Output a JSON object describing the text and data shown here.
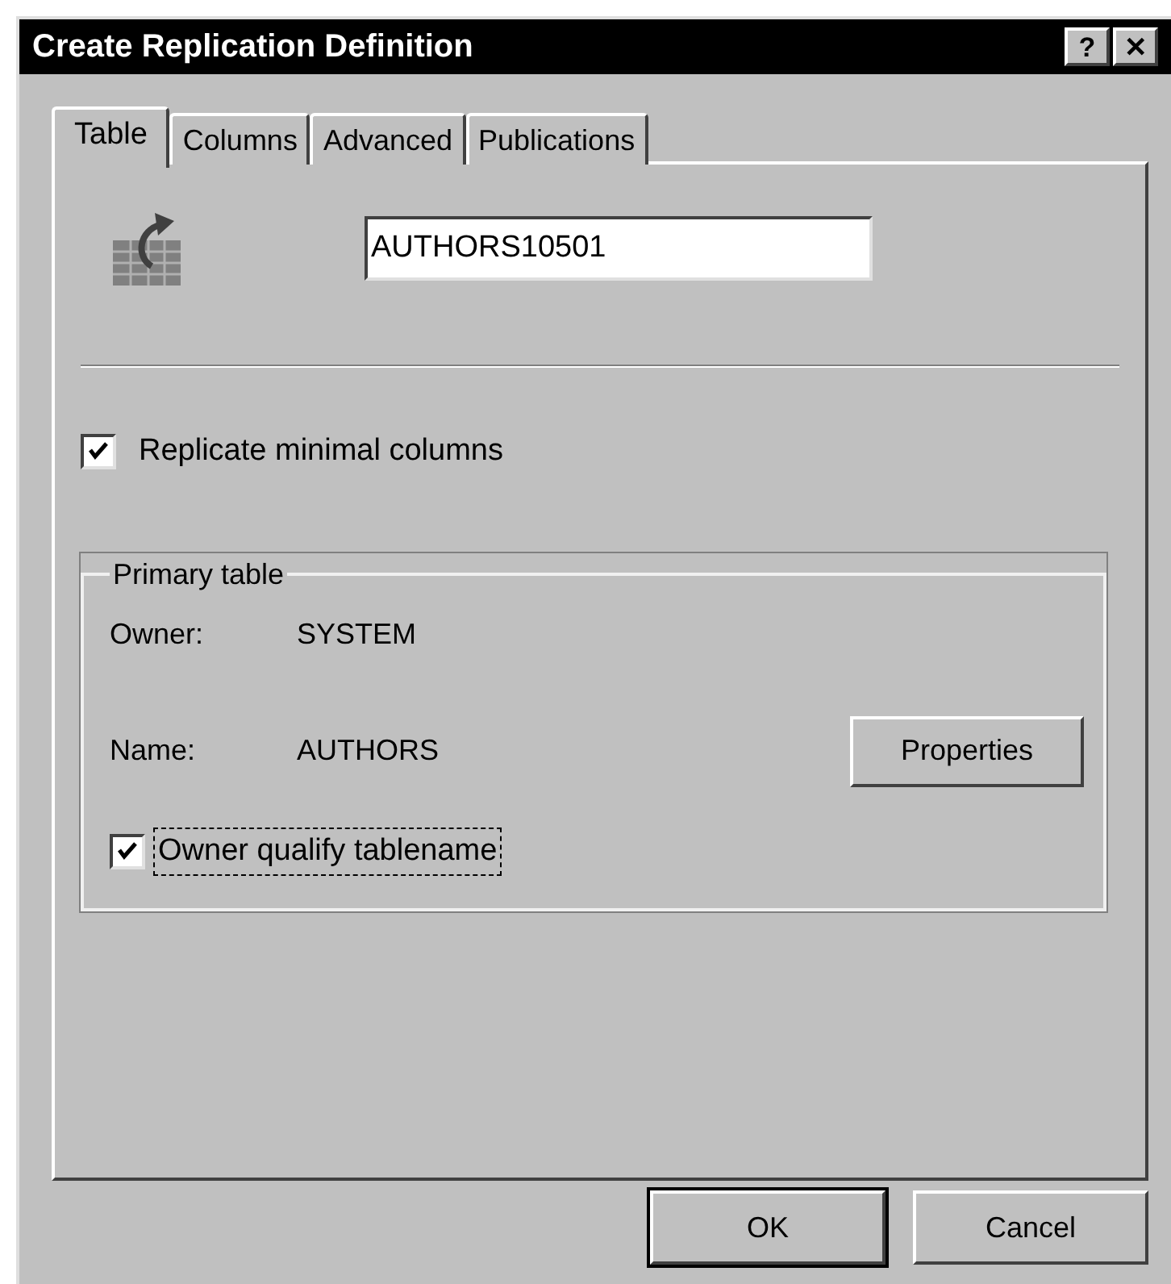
{
  "window": {
    "title": "Create Replication Definition",
    "title_buttons": [
      "?",
      "✕"
    ]
  },
  "tabs": [
    {
      "label": "Table",
      "selected": true
    },
    {
      "label": "Columns",
      "selected": false
    },
    {
      "label": "Advanced",
      "selected": false
    },
    {
      "label": "Publications",
      "selected": false
    }
  ],
  "definition_name": {
    "value": "AUTHORS10501"
  },
  "replicate_minimal_columns": {
    "label": "Replicate minimal columns",
    "checked": true
  },
  "primary_table": {
    "legend": "Primary table",
    "fields": [
      {
        "label": "Owner:",
        "value": "SYSTEM"
      },
      {
        "label": "Name:",
        "value": "AUTHORS"
      }
    ],
    "properties_button": "Properties",
    "owner_qualify": {
      "label": "Owner qualify tablename",
      "checked": true,
      "focused": true
    }
  },
  "buttons": [
    {
      "label": "OK",
      "default": true
    },
    {
      "label": "Cancel",
      "default": false
    }
  ]
}
